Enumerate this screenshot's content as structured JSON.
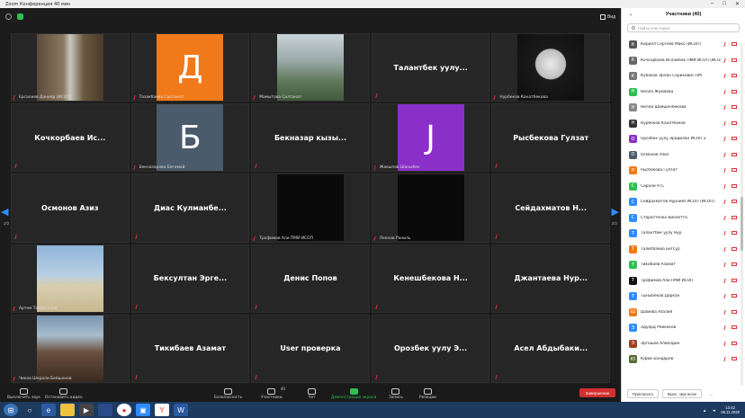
{
  "window": {
    "title": "Zoom Конференция 40 мин"
  },
  "view_label": "Вид",
  "grid": {
    "tiles": [
      {
        "kind": "photo",
        "photo": "waterfall",
        "caption": "Ерсалиев Данияр (ИСОП)"
      },
      {
        "kind": "avatar",
        "letter": "Д",
        "color": "#f07a1a",
        "caption": "Тазакбаева Салтанат"
      },
      {
        "kind": "photo",
        "photo": "mountain",
        "caption": "Мамытова Салтанат"
      },
      {
        "kind": "name",
        "name": "Талантбек уулу...",
        "caption": ""
      },
      {
        "kind": "photo",
        "photo": "dark",
        "caption": "Нурбеков Канатбекова"
      },
      {
        "kind": "name",
        "name": "Кочкорбаев Ис...",
        "caption": ""
      },
      {
        "kind": "avatar",
        "letter": "Б",
        "color": "#4a5b6b",
        "caption": "Бекназарова Бегимай"
      },
      {
        "kind": "name",
        "name": "Бекназар кызы...",
        "caption": ""
      },
      {
        "kind": "avatar",
        "letter": "J",
        "color": "#8b2fc9",
        "caption": "Жакыпов Шаныбек"
      },
      {
        "kind": "name",
        "name": "Рысбекова Гулзат",
        "caption": ""
      },
      {
        "kind": "name",
        "name": "Осмонов Азиз",
        "caption": ""
      },
      {
        "kind": "name",
        "name": "Диас Кулманбе...",
        "caption": ""
      },
      {
        "kind": "black",
        "caption": "Трофимов Али ПМИ ИСОП"
      },
      {
        "kind": "black",
        "caption": "Леонов Раниль"
      },
      {
        "kind": "name",
        "name": "Сейдахматов Н...",
        "caption": ""
      },
      {
        "kind": "photo",
        "photo": "beach",
        "caption": "Артем Топоргулов"
      },
      {
        "kind": "name",
        "name": "Бексултан Эрге...",
        "caption": ""
      },
      {
        "kind": "name",
        "name": "Денис Попов",
        "caption": ""
      },
      {
        "kind": "name",
        "name": "Кенешбекова Н...",
        "caption": ""
      },
      {
        "kind": "name",
        "name": "Джантаева Нур...",
        "caption": ""
      },
      {
        "kind": "photo",
        "photo": "selfie",
        "caption": "Чиков Шерали Бейшенов"
      },
      {
        "kind": "name",
        "name": "Тикибаев Азамат",
        "caption": ""
      },
      {
        "kind": "name",
        "name": "User проверка",
        "caption": ""
      },
      {
        "kind": "name",
        "name": "Орозбек уулу Э...",
        "caption": ""
      },
      {
        "kind": "name",
        "name": "Асел Абдыбаки...",
        "caption": ""
      }
    ]
  },
  "pager": {
    "left": "2/2",
    "right": "2/2"
  },
  "toolbar": {
    "mute": "Выключить звук",
    "video": "Остановить видео",
    "security": "Безопасность",
    "participants": "Участники",
    "participants_count": "40",
    "chat": "Чат",
    "share": "Демонстрация экрана",
    "record": "Запись",
    "reactions": "Реакции",
    "end": "Завершение"
  },
  "panel": {
    "title": "Участники (40)",
    "search_placeholder": "Найти участника",
    "participants": [
      {
        "letter": "К",
        "color": "#555",
        "name": "Кирилл Сергеев Мако (ИСОП)"
      },
      {
        "letter": "К",
        "color": "#666",
        "name": "Кочкорбаев Исламбек ПМИ ИСОП (ИСОП)"
      },
      {
        "letter": "К",
        "color": "#777",
        "name": "Кубаков Эрлан Серикович ПМ"
      },
      {
        "letter": "Н",
        "color": "#2fbf4f",
        "name": "Нелла Жумаева"
      },
      {
        "letter": "Н",
        "color": "#888",
        "name": "Нелли Шейшенбекова"
      },
      {
        "letter": "Н",
        "color": "#333",
        "name": "Нурбеков Канатбеков"
      },
      {
        "letter": "О",
        "color": "#8b2fc9",
        "name": "Орозбек уулу Эрадилан ИСОП 2"
      },
      {
        "letter": "О",
        "color": "#4a5b6b",
        "name": "Осмонов Азиз"
      },
      {
        "letter": "Р",
        "color": "#f07a1a",
        "name": "Рысбекова Гулзат"
      },
      {
        "letter": "С",
        "color": "#2fbf4f",
        "name": "Сирали УТС"
      },
      {
        "letter": "С",
        "color": "#2d8cff",
        "name": "Сейдахматов Нурнияз ИСОП (ИСОП)"
      },
      {
        "letter": "С",
        "color": "#2d8cff",
        "name": "Старостенко Виолетта"
      },
      {
        "letter": "Т",
        "color": "#2d8cff",
        "name": "Талантбек уулу Нур"
      },
      {
        "letter": "Т",
        "color": "#f07a1a",
        "name": "Талипбаева Бегсур"
      },
      {
        "letter": "Т",
        "color": "#2fbf4f",
        "name": "Тикибаев Азамат"
      },
      {
        "letter": "Т",
        "color": "#111",
        "name": "Трофимов Али ПМИ ИСОП"
      },
      {
        "letter": "Т",
        "color": "#2d8cff",
        "name": "Тыныбеков Даркан"
      },
      {
        "letter": "Ш",
        "color": "#f07a1a",
        "name": "Шаиева Азалия"
      },
      {
        "letter": "Э",
        "color": "#2d8cff",
        "name": "Эдуард Ревенков"
      },
      {
        "letter": "Э",
        "color": "#a04020",
        "name": "Эргешов Алмаздин"
      },
      {
        "letter": "Ю",
        "color": "#556b2f",
        "name": "Юрий Бондарев"
      }
    ],
    "invite": "Пригласить",
    "mute_all": "Выкл. звук всем",
    "more": "..."
  },
  "taskbar": {
    "time": "13:42",
    "date": "06.11.2020"
  }
}
